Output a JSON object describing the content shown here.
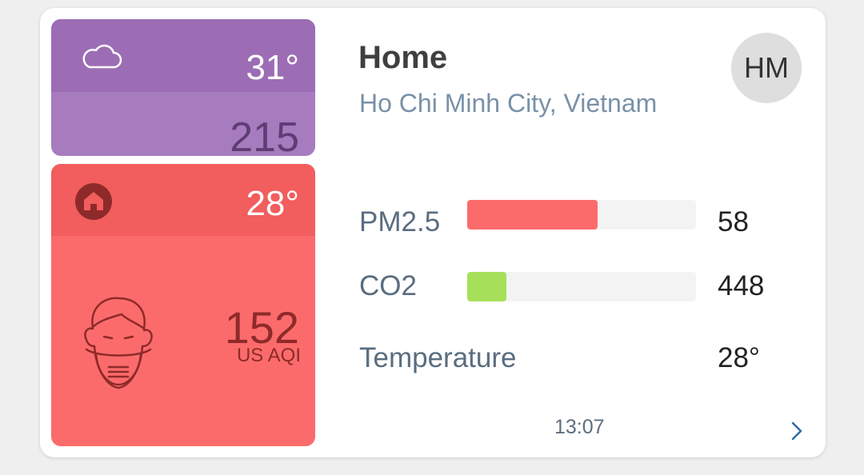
{
  "outdoor": {
    "icon": "cloud-icon",
    "temperature": "31°",
    "aqi": "215",
    "color": "#9c6db5"
  },
  "indoor": {
    "icon": "home-icon",
    "temperature": "28°",
    "aqi": "152",
    "aqi_unit": "US AQI",
    "face_icon": "face-mask-icon",
    "color": "#fc6b6b"
  },
  "station": {
    "name": "Home",
    "location": "Ho Chi Minh City, Vietnam",
    "avatar_initials": "HM"
  },
  "metrics": [
    {
      "label": "PM2.5",
      "value": "58",
      "level": 0.57,
      "bar_color": "#fc6b6b"
    },
    {
      "label": "CO2",
      "value": "448",
      "level": 0.17,
      "bar_color": "#a6e05a"
    },
    {
      "label": "Temperature",
      "value": "28°"
    }
  ],
  "footer": {
    "time": "13:07",
    "chevron_icon": "chevron-right-icon"
  }
}
